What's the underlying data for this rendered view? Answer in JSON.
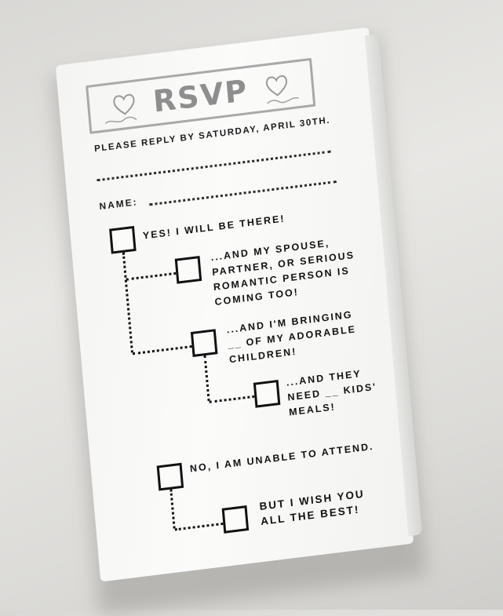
{
  "card": {
    "title": "RSVP",
    "reply_by": "PLEASE REPLY BY SATURDAY, APRIL 30TH.",
    "name_label": "NAME:"
  },
  "options": {
    "yes": "YES! I WILL BE THERE!",
    "spouse": "...AND MY SPOUSE, PARTNER, OR SERIOUS ROMANTIC PERSON IS COMING TOO!",
    "children": "...AND I'M BRINGING __ OF MY ADORABLE CHILDREN!",
    "kids_meals": "...AND THEY NEED __ KIDS' MEALS!",
    "no": "NO, I AM UNABLE TO ATTEND.",
    "best": "BUT I WISH YOU ALL THE BEST!"
  },
  "colors": {
    "ink": "#111111",
    "header_gray": "#8e8e8e",
    "paper": "#fbfbfa",
    "background": "#dedddb"
  },
  "icons": [
    "heart-icon",
    "swirl-icon",
    "checkbox"
  ]
}
